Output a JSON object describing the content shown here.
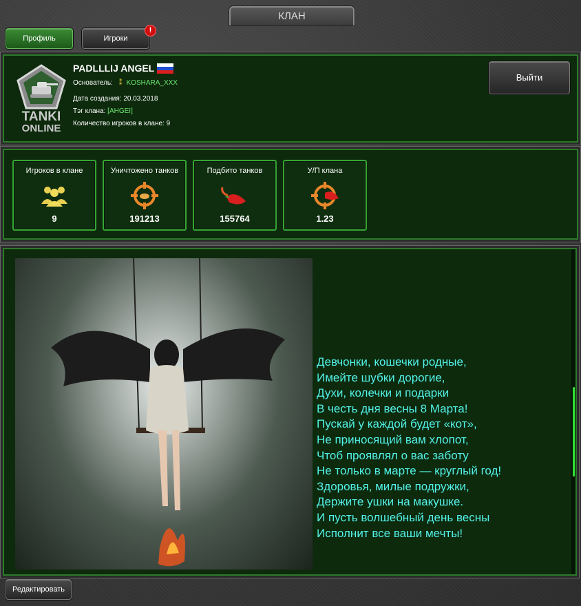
{
  "window": {
    "title": "КЛАН"
  },
  "tabs": [
    {
      "label": "Профиль",
      "active": true
    },
    {
      "label": "Игроки",
      "active": false,
      "badge": "!"
    }
  ],
  "clan": {
    "logo_text_top": "TANKI",
    "logo_text_bottom": "ONLINE",
    "name": "PADLLLIJ ANGEL",
    "founder_label": "Основатель:",
    "founder": "KOSHARA_XXX",
    "created_label": "Дата создания:",
    "created": "20.03.2018",
    "tag_label": "Тэг клана:",
    "tag": "[AHGEI]",
    "players_label": "Количество игроков в клане:",
    "players": "9",
    "flag": "russia-flag-icon",
    "leave_button": "Выйти"
  },
  "stats": [
    {
      "label": "Игроков в клане",
      "value": "9",
      "icon": "players-icon"
    },
    {
      "label": "Уничтожено танков",
      "value": "191213",
      "icon": "crosshair-destroyed-icon"
    },
    {
      "label": "Подбито танков",
      "value": "155764",
      "icon": "pepper-icon"
    },
    {
      "label": "У/П клана",
      "value": "1.23",
      "icon": "crosshair-pepper-icon"
    }
  ],
  "description": {
    "image": "angel-swing-image",
    "poem": [
      "Девчонки, кошечки родные,",
      "Имейте шубки дорогие,",
      "Духи, колечки и подарки",
      "В честь дня весны 8 Марта!",
      "Пускай у каждой будет «кот»,",
      "Не приносящий вам хлопот,",
      "Чтоб проявлял о вас заботу",
      "Не только в марте — круглый год!",
      "Здоровья, милые подружки,",
      "Держите ушки на макушке.",
      "И пусть волшебный день весны",
      "Исполнит все ваши мечты!"
    ]
  },
  "footer": {
    "edit_button": "Редактировать"
  },
  "colors": {
    "accent": "#35a533",
    "panel_bg": "#0d2a0d",
    "poem_text": "#53f2e8",
    "tag_text": "#6ee86e"
  }
}
